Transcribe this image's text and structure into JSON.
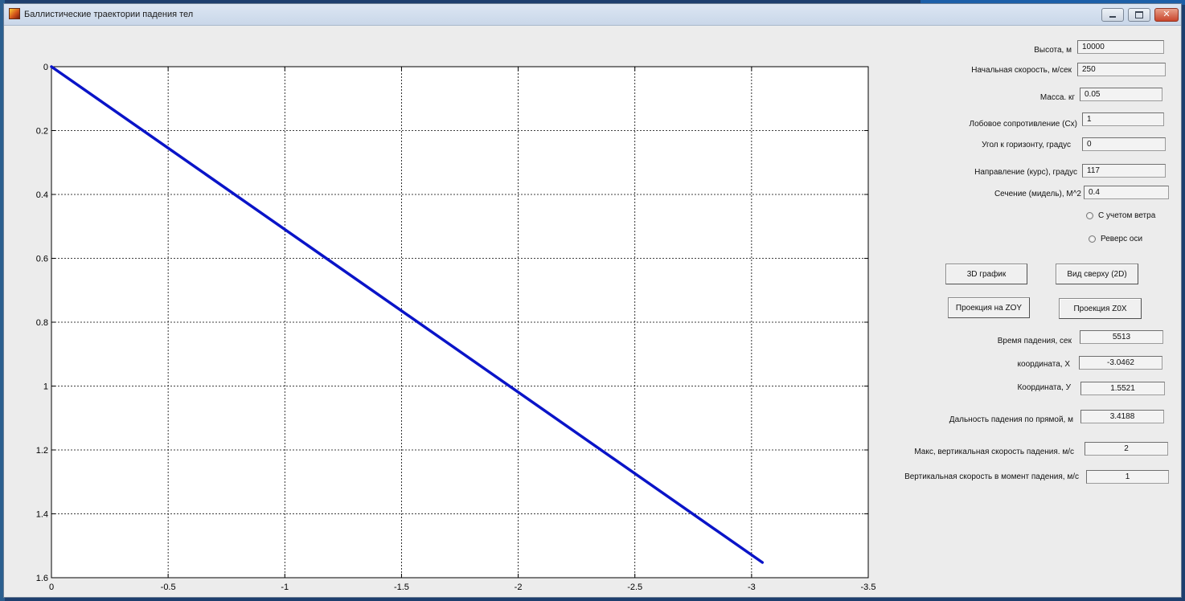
{
  "window": {
    "title": "Баллистические траектории падения тел",
    "controls": [
      "minimize-icon",
      "maximize-icon",
      "close-icon"
    ]
  },
  "inputs": [
    {
      "label": "Высота, м",
      "value": "10000"
    },
    {
      "label": "Начальная скорость, м/сек",
      "value": "250"
    },
    {
      "label": "Масса. кг",
      "value": "0.05"
    },
    {
      "label": "Лобовое сопротивление (Cx)",
      "value": "1"
    },
    {
      "label": "Угол к горизонту, градус",
      "value": "0"
    },
    {
      "label": "Направление  (курс), градус",
      "value": "117"
    },
    {
      "label": "Сечение (мидель), M^2",
      "value": "0.4"
    }
  ],
  "options": [
    {
      "label": "С учетом ветра",
      "checked": false
    },
    {
      "label": "Реверс оси",
      "checked": false
    }
  ],
  "buttons": {
    "plot3d": "3D график",
    "top_view": "Вид сверху (2D)",
    "proj_zoy": "Проекция на ZOY",
    "proj_zox": "Проекция Z0X"
  },
  "results": [
    {
      "label": "Время падения, сек",
      "value": "5513"
    },
    {
      "label": "координата, X",
      "value": "-3.0462"
    },
    {
      "label": "Координата, У",
      "value": "1.5521"
    },
    {
      "label": "Дальность падения по прямой, м",
      "value": "3.4188"
    },
    {
      "label": "Макс,  вертикальная скорость падения. м/с",
      "value": "2"
    },
    {
      "label": "Вертикальная  скорость в момент падения, м/с",
      "value": "1"
    }
  ],
  "colors": {
    "trajectory": "#0a14c8",
    "plot_bg": "#ffffff",
    "panel_bg": "#ececec"
  },
  "chart_data": {
    "type": "line",
    "title": "",
    "xlabel": "",
    "ylabel": "",
    "xlim": [
      0,
      -3.5
    ],
    "ylim": [
      0,
      1.6
    ],
    "x_reversed": true,
    "y_reversed": true,
    "grid": true,
    "x_ticks": [
      "0",
      "-0.5",
      "-1",
      "-1.5",
      "-2",
      "-2.5",
      "-3",
      "-3.5"
    ],
    "y_ticks": [
      "0",
      "0.2",
      "0.4",
      "0.6",
      "0.8",
      "1",
      "1.2",
      "1.4",
      "1.6"
    ],
    "series": [
      {
        "x": [
          0,
          -3.0462
        ],
        "y": [
          0,
          1.5521
        ]
      }
    ]
  }
}
